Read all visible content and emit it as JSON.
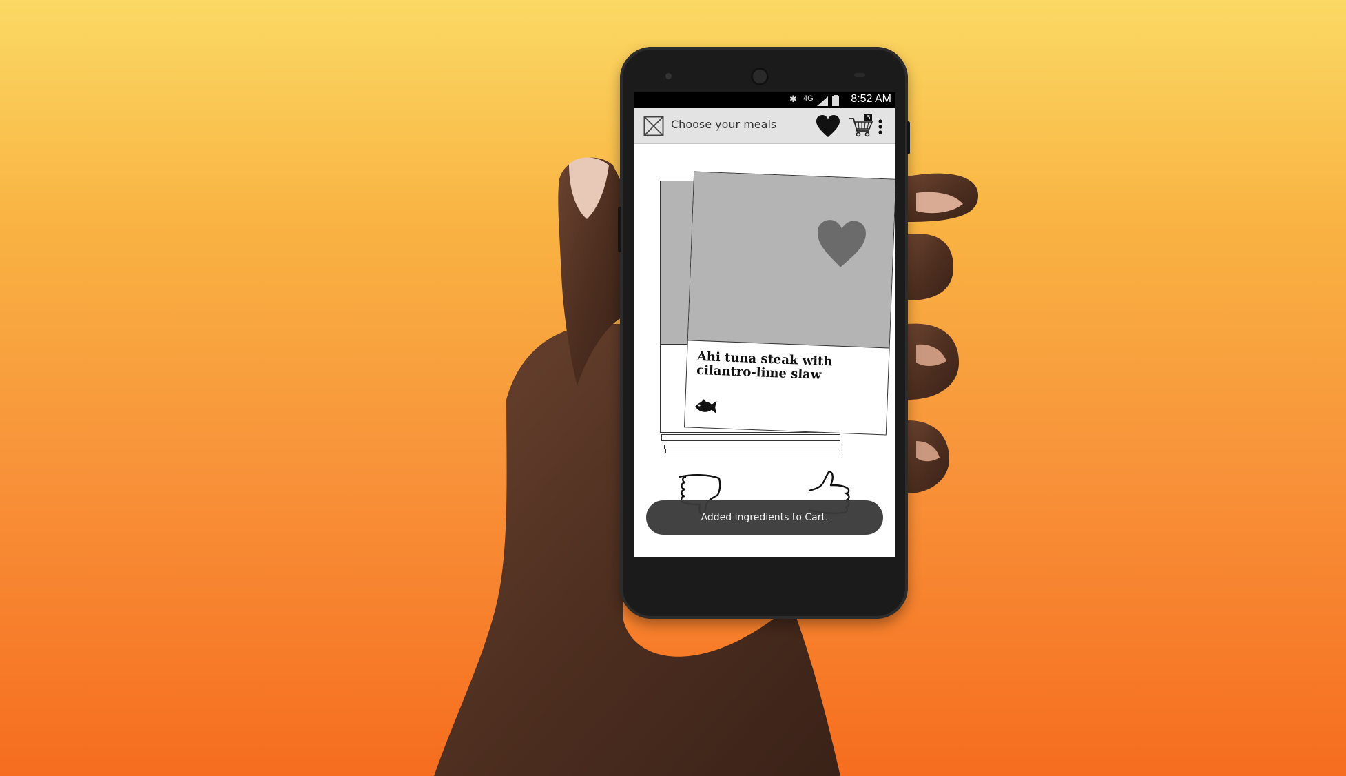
{
  "status_bar": {
    "time": "8:52 AM",
    "icons": [
      "bluetooth-icon",
      "4g-lte-icon",
      "signal-icon",
      "battery-icon"
    ],
    "network": "4G"
  },
  "app_bar": {
    "title": "Choose your meals",
    "nav_icon": "image-placeholder-icon",
    "favorites_icon": "heart-icon",
    "cart_icon": "cart-icon",
    "cart_count": "5",
    "overflow_icon": "more-vert-icon"
  },
  "meal_card": {
    "name": "Ahi tuna steak with cilantro-lime slaw",
    "category_icon": "fish-icon",
    "photo_color": "#b4b4b4",
    "favorite_icon": "heart-icon"
  },
  "actions": {
    "dislike_icon": "thumbs-down-icon",
    "like_icon": "thumbs-up-icon"
  },
  "toast": {
    "message": "Added ingredients to Cart."
  },
  "colors": {
    "background_top": "#fbd964",
    "background_bottom": "#f66d1f",
    "app_bar": "#e3e3e3",
    "toast": "#3a3a3a"
  }
}
